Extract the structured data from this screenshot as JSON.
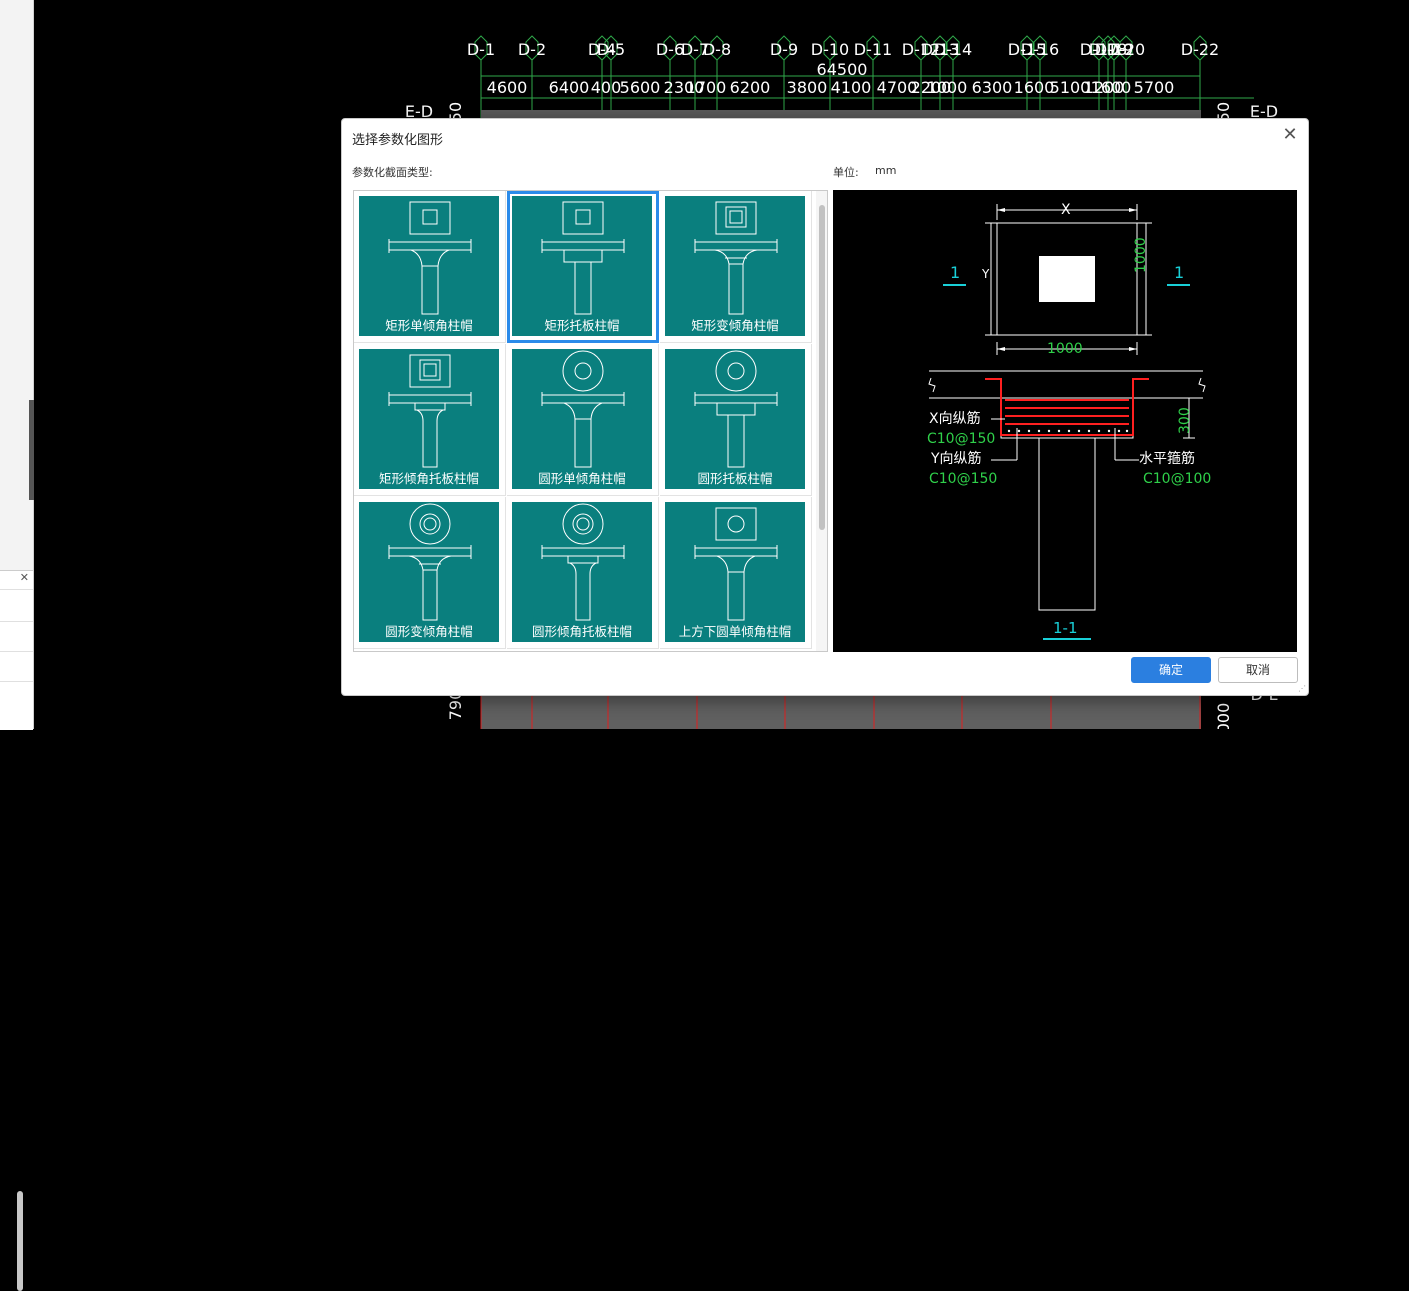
{
  "dialog": {
    "title": "选择参数化图形",
    "type_label": "参数化截面类型:",
    "unit_label": "单位:",
    "unit_value": "mm",
    "ok_label": "确定",
    "cancel_label": "取消"
  },
  "shapes": [
    {
      "label": "矩形单倾角柱帽",
      "head": "rect",
      "inner": "rect",
      "neck": "taper",
      "selected": false
    },
    {
      "label": "矩形托板柱帽",
      "head": "rect",
      "inner": "rect",
      "neck": "plate",
      "selected": true
    },
    {
      "label": "矩形变倾角柱帽",
      "head": "rect",
      "inner": "rect2",
      "neck": "taper2",
      "selected": false
    },
    {
      "label": "矩形倾角托板柱帽",
      "head": "rect",
      "inner": "rect2",
      "neck": "plate-taper",
      "selected": false
    },
    {
      "label": "圆形单倾角柱帽",
      "head": "circle",
      "inner": "circle",
      "neck": "taper",
      "selected": false
    },
    {
      "label": "圆形托板柱帽",
      "head": "circle",
      "inner": "circle",
      "neck": "plate",
      "selected": false
    },
    {
      "label": "圆形变倾角柱帽",
      "head": "circle",
      "inner": "circle2",
      "neck": "taper2",
      "selected": false
    },
    {
      "label": "圆形倾角托板柱帽",
      "head": "circle",
      "inner": "circle2",
      "neck": "plate-taper",
      "selected": false
    },
    {
      "label": "上方下圆单倾角柱帽",
      "head": "rect",
      "inner": "circle",
      "neck": "taper",
      "selected": false
    }
  ],
  "preview": {
    "dim_x": "X",
    "dim_y": "Y",
    "dim_bottom": "1000",
    "dim_right": "1000",
    "section_mark_left": "1",
    "section_mark_right": "1",
    "dim_height": "300",
    "x_bar_label": "X向纵筋",
    "x_bar_value": "C10@150",
    "y_bar_label": "Y向纵筋",
    "y_bar_value": "C10@150",
    "stirrup_label": "水平箍筋",
    "stirrup_value": "C10@100",
    "section_title": "1-1"
  },
  "cad": {
    "axis_labels": [
      "D-1",
      "D-2",
      "D-4",
      "D-5",
      "D-6",
      "D-7",
      "D-8",
      "D-9",
      "D-10",
      "D-11",
      "D-12",
      "D-13",
      "D-14",
      "D-15",
      "D-16",
      "D-17",
      "D-18",
      "D-19",
      "D-20",
      "D-22"
    ],
    "total_span": "64500",
    "spans": [
      "4600",
      "6400",
      "400",
      "5600",
      "2300",
      "1700",
      "6200",
      "3800",
      "4100",
      "4700",
      "2200",
      "1000",
      "6300",
      "1600",
      "5100",
      "1200",
      "1600",
      "5700"
    ],
    "row_label_left": "E-D",
    "row_label_right": "E-D",
    "row_label_bottom_right": "D-L",
    "left_dim_top": "50",
    "right_dim_top": "50",
    "left_dim_bottom": "790",
    "right_dim_bottom": "000"
  },
  "colors": {
    "teal": "#0a7f7e",
    "accent": "#2b7fe0",
    "cad_green": "#2fa84a",
    "rebar_red": "#ff2020",
    "cyan": "#19d0d8"
  }
}
